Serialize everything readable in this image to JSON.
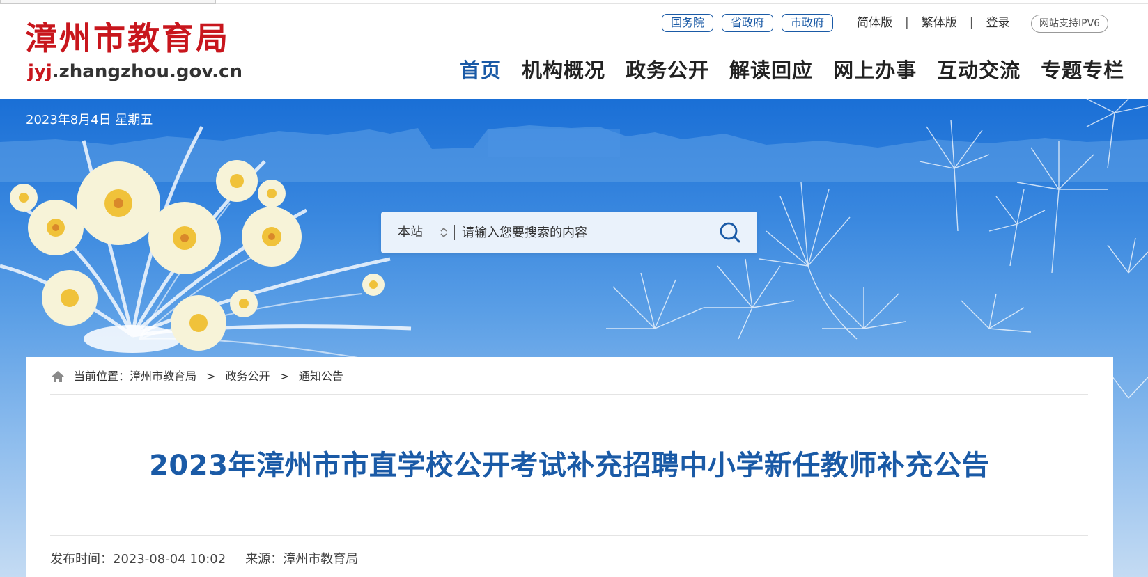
{
  "site": {
    "logo_cn": "漳州市教育局",
    "logo_en_highlight": "jyj",
    "logo_en_rest": ".zhangzhou.gov.cn"
  },
  "gov_links": [
    "国务院",
    "省政府",
    "市政府"
  ],
  "utility": {
    "simplified": "简体版",
    "traditional": "繁体版",
    "login": "登录",
    "sep": "|",
    "ipv6": "网站支持IPV6"
  },
  "nav": [
    {
      "label": "首页",
      "active": true
    },
    {
      "label": "机构概况",
      "active": false
    },
    {
      "label": "政务公开",
      "active": false
    },
    {
      "label": "解读回应",
      "active": false
    },
    {
      "label": "网上办事",
      "active": false
    },
    {
      "label": "互动交流",
      "active": false
    },
    {
      "label": "专题专栏",
      "active": false
    }
  ],
  "banner": {
    "date": "2023年8月4日 星期五"
  },
  "search": {
    "scope": "本站",
    "placeholder": "请输入您要搜索的内容",
    "icon": "search-icon"
  },
  "breadcrumb": {
    "prefix": "当前位置：",
    "items": [
      "漳州市教育局",
      "政务公开",
      "通知公告"
    ],
    "sep": ">"
  },
  "article": {
    "title": "2023年漳州市市直学校公开考试补充招聘中小学新任教师补充公告",
    "publish_label": "发布时间：",
    "publish_time": "2023-08-04 10:02",
    "source_label": "来源：",
    "source": "漳州市教育局"
  },
  "colors": {
    "brand_red": "#c8161d",
    "brand_blue": "#1a5aa6"
  }
}
